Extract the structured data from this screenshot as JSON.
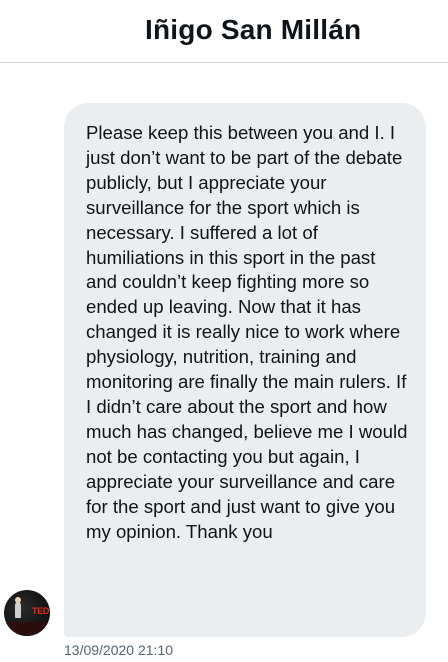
{
  "header": {
    "title": "Iñigo San Millán"
  },
  "message": {
    "text": "Please keep this between you and I. I just don’t want to be part of the debate publicly, but I appreciate your surveillance for the sport which is necessary. I suffered a lot of humiliations in this sport in the past and couldn’t keep fighting more so ended up leaving. Now that it has changed it is really nice to work where physiology, nutrition, training and monitoring are finally the main rulers. If I didn’t care about the sport and how much has changed, believe me I would not be contacting you but again, I appreciate your surveillance and care for the sport and just want to give you my opinion. Thank you",
    "timestamp": "13/09/2020 21:10"
  },
  "avatar": {
    "logo_text": "TED"
  },
  "colors": {
    "bubble": "#ebeef0",
    "text": "#0f1419",
    "muted": "#536471",
    "divider": "#d4d8dd"
  }
}
